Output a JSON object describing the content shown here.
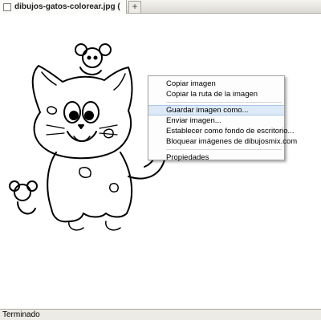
{
  "tab": {
    "title": "dibujos-gatos-colorear.jpg (JPEG Ima...",
    "new_tab_label": "+"
  },
  "image": {
    "alt": "dibujos gatos colorear"
  },
  "context_menu": {
    "items": [
      {
        "label": "Copiar imagen"
      },
      {
        "label": "Copiar la ruta de la imagen"
      },
      {
        "label": "Guardar imagen como..."
      },
      {
        "label": "Enviar imagen..."
      },
      {
        "label": "Establecer como fondo de escritorio..."
      },
      {
        "label": "Bloquear imágenes de dibujosmix.com"
      },
      {
        "label": "Propiedades"
      }
    ],
    "highlighted_index": 2
  },
  "status": {
    "text": "Terminado"
  }
}
